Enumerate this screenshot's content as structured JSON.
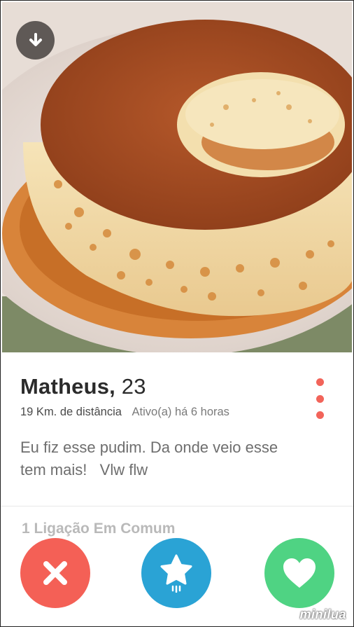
{
  "profile": {
    "name": "Matheus,",
    "age": "23",
    "distance": "19 Km. de distância",
    "active": "Ativo(a) há 6 horas",
    "bio_lines": [
      "Eu fiz esse pudim. Da onde veio esse",
      "tem mais!   Vlw flw"
    ],
    "mutual": "1 Ligação Em Comum"
  },
  "icons": {
    "download": "download-arrow-icon",
    "more": "vertical-dots-icon",
    "nope": "x-icon",
    "super_like": "star-icon",
    "like": "heart-icon"
  },
  "colors": {
    "accent_red": "#f46056",
    "super_blue": "#2aa3d5",
    "like_green": "#4fd383",
    "menu_dots": "#f2645a"
  },
  "watermark": "minilua"
}
